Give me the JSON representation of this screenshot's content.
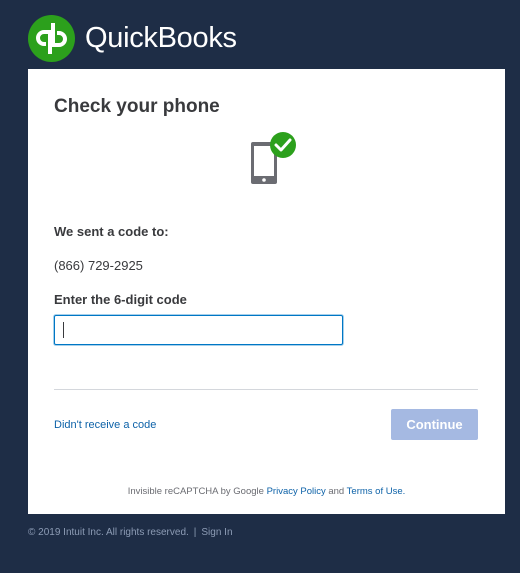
{
  "brand": {
    "name": "QuickBooks",
    "logo_icon": "quickbooks-qb-icon",
    "logo_color": "#2ca01c"
  },
  "page": {
    "background_color": "#1e2d46",
    "title": "Check your phone",
    "status_icon": "phone-check-icon"
  },
  "verification": {
    "sent_label": "We sent a code to:",
    "phone_number": "(866) 729-2925",
    "code_label": "Enter the 6-digit code",
    "code_value": "",
    "code_placeholder": ""
  },
  "actions": {
    "resend_link": "Didn't receive a code",
    "continue_label": "Continue",
    "continue_color": "#a5b9e2"
  },
  "recaptcha": {
    "prefix": "Invisible reCAPTCHA by Google",
    "privacy_link": "Privacy Policy",
    "and": "and",
    "terms_link": "Terms of Use."
  },
  "footer": {
    "copyright": "© 2019 Intuit Inc. All rights reserved.",
    "separator": "|",
    "sign_in": "Sign In"
  }
}
